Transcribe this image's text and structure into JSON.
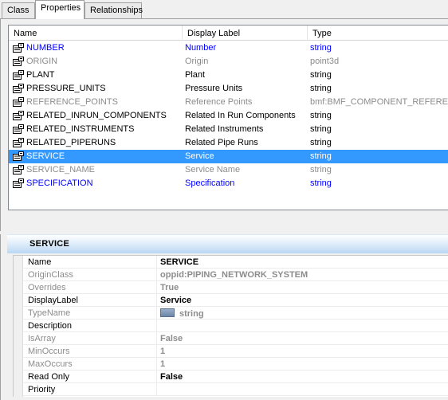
{
  "tabs": [
    {
      "label": "Class",
      "active": false
    },
    {
      "label": "Properties",
      "active": true
    },
    {
      "label": "Relationships",
      "active": false
    }
  ],
  "grid": {
    "columns": {
      "name": "Name",
      "label": "Display Label",
      "type": "Type"
    },
    "rows": [
      {
        "name": "NUMBER",
        "label": "Number",
        "type": "string",
        "style": "blue",
        "selected": false
      },
      {
        "name": "ORIGIN",
        "label": "Origin",
        "type": "point3d",
        "style": "grey",
        "selected": false
      },
      {
        "name": "PLANT",
        "label": "Plant",
        "type": "string",
        "style": "normal",
        "selected": false
      },
      {
        "name": "PRESSURE_UNITS",
        "label": "Pressure Units",
        "type": "string",
        "style": "normal",
        "selected": false
      },
      {
        "name": "REFERENCE_POINTS",
        "label": "Reference Points",
        "type": "bmf:BMF_COMPONENT_REFERENCE",
        "style": "grey",
        "selected": false
      },
      {
        "name": "RELATED_INRUN_COMPONENTS",
        "label": "Related In Run Components",
        "type": "string",
        "style": "normal",
        "selected": false
      },
      {
        "name": "RELATED_INSTRUMENTS",
        "label": "Related Instruments",
        "type": "string",
        "style": "normal",
        "selected": false
      },
      {
        "name": "RELATED_PIPERUNS",
        "label": "Related Pipe Runs",
        "type": "string",
        "style": "normal",
        "selected": false
      },
      {
        "name": "SERVICE",
        "label": "Service",
        "type": "string",
        "style": "normal",
        "selected": true
      },
      {
        "name": "SERVICE_NAME",
        "label": "Service Name",
        "type": "string",
        "style": "grey",
        "selected": false
      },
      {
        "name": "SPECIFICATION",
        "label": "Specification",
        "type": "string",
        "style": "blue",
        "selected": false
      }
    ]
  },
  "details": {
    "title": "SERVICE",
    "rows": [
      {
        "key": "Name",
        "value": "SERVICE",
        "key_style": "normal",
        "val_style": "normal"
      },
      {
        "key": "OriginClass",
        "value": "oppid:PIPING_NETWORK_SYSTEM",
        "key_style": "grey",
        "val_style": "grey"
      },
      {
        "key": "Overrides",
        "value": "True",
        "key_style": "grey",
        "val_style": "grey"
      },
      {
        "key": "DisplayLabel",
        "value": "Service",
        "key_style": "normal",
        "val_style": "normal"
      },
      {
        "key": "TypeName",
        "value": "string",
        "key_style": "grey",
        "val_style": "grey",
        "swatch": true
      },
      {
        "key": "Description",
        "value": "",
        "key_style": "normal",
        "val_style": "normal"
      },
      {
        "key": "IsArray",
        "value": "False",
        "key_style": "grey",
        "val_style": "grey"
      },
      {
        "key": "MinOccurs",
        "value": "1",
        "key_style": "grey",
        "val_style": "grey"
      },
      {
        "key": "MaxOccurs",
        "value": "1",
        "key_style": "grey",
        "val_style": "grey"
      },
      {
        "key": "Read Only",
        "value": "False",
        "key_style": "normal",
        "val_style": "normal"
      },
      {
        "key": "Priority",
        "value": "",
        "key_style": "normal",
        "val_style": "normal"
      }
    ]
  },
  "colors": {
    "selection": "#3399ff",
    "link_blue": "#0000ff",
    "disabled_grey": "#8c8c8c",
    "section_header": "#cfe4f7"
  },
  "icons": {
    "property_row": "property-icon"
  }
}
